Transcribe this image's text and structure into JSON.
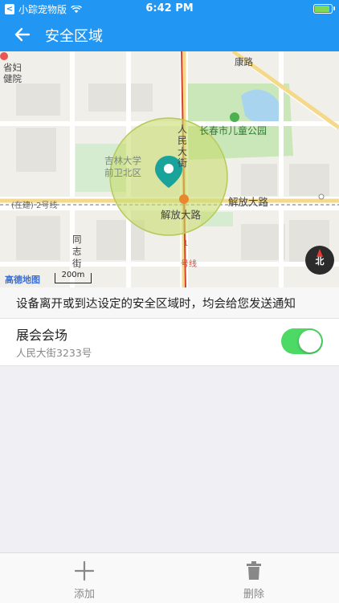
{
  "status_bar": {
    "carrier": "小踪宠物版",
    "time": "6:42 PM",
    "battery_level": 0.8
  },
  "navbar": {
    "title": "安全区域"
  },
  "map": {
    "labels": {
      "province_hospital_1": "省妇",
      "province_hospital_2": "健院",
      "kangle_road": "康路",
      "children_park": "长春市儿童公园",
      "renmin_avenue_1": "人",
      "renmin_avenue_2": "民",
      "renmin_avenue_3": "大",
      "renmin_avenue_4": "街",
      "jilin_univ_1": "吉林大学",
      "jilin_univ_2": "前卫北区",
      "metro_line": "(在建) 2号线",
      "jiefang_road_marker": "解放大路",
      "jiefang_road_right": "解放大路",
      "tongzhi_1": "同",
      "tongzhi_2": "志",
      "tongzhi_3": "街",
      "line1_a": "1",
      "line1_b": "号线"
    },
    "logo": "高德地图",
    "scale": "200m",
    "compass": "北"
  },
  "banner": {
    "text": "设备离开或到达设定的安全区域时，均会给您发送通知"
  },
  "zone": {
    "name": "展会会场",
    "address": "人民大街3233号",
    "enabled": true
  },
  "tabbar": {
    "add_label": "添加",
    "delete_label": "删除"
  },
  "colors": {
    "primary": "#2196f3",
    "toggle_on": "#4cd964",
    "zone_fill": "#c8dc6e",
    "marker": "#1aa39a"
  }
}
